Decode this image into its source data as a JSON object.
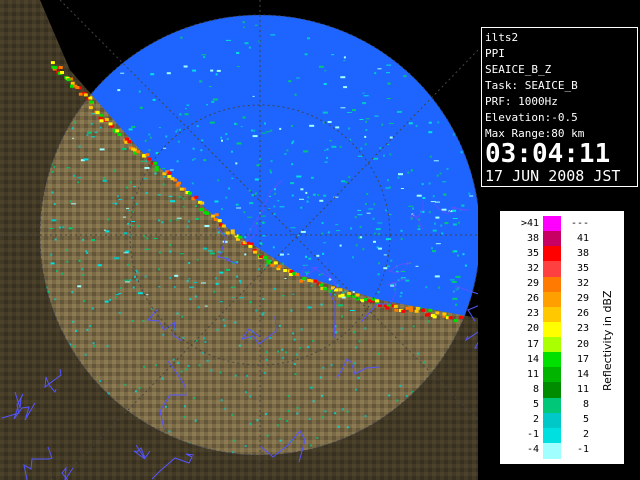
{
  "info": {
    "station": "ilts2",
    "mode": "PPI",
    "product": "SEAICE_B_Z",
    "task": "Task: SEAICE_B",
    "prf": "PRF: 1000Hz",
    "elevation": "Elevation:-0.5",
    "max_range": "Max Range:80 km",
    "time": "03:04:11",
    "date": "17 JUN 2008 JST"
  },
  "legend": {
    "unit_label": "Reflectivity in dBZ",
    "bins": [
      {
        "low": ">41",
        "high": "---",
        "color": "#ff00ff"
      },
      {
        "low": "38",
        "high": "41",
        "color": "#c80064"
      },
      {
        "low": "35",
        "high": "38",
        "color": "#ff0000"
      },
      {
        "low": "32",
        "high": "35",
        "color": "#ff4040"
      },
      {
        "low": "29",
        "high": "32",
        "color": "#ff7a00"
      },
      {
        "low": "26",
        "high": "29",
        "color": "#ffa000"
      },
      {
        "low": "23",
        "high": "26",
        "color": "#ffc800"
      },
      {
        "low": "20",
        "high": "23",
        "color": "#ffff00"
      },
      {
        "low": "17",
        "high": "20",
        "color": "#aaff00"
      },
      {
        "low": "14",
        "high": "17",
        "color": "#00e000"
      },
      {
        "low": "11",
        "high": "14",
        "color": "#00b400"
      },
      {
        "low": "8",
        "high": "11",
        "color": "#008c00"
      },
      {
        "low": "5",
        "high": "8",
        "color": "#00c878"
      },
      {
        "low": "2",
        "high": "5",
        "color": "#00c8c8"
      },
      {
        "low": "-1",
        "high": "2",
        "color": "#00e0e0"
      },
      {
        "low": "-4",
        "high": "-1",
        "color": "#a0ffff"
      }
    ]
  },
  "colors": {
    "sea": "#1e64ff",
    "land": "#7a6a45",
    "background": "#000000",
    "rivers": "#5555ff"
  }
}
